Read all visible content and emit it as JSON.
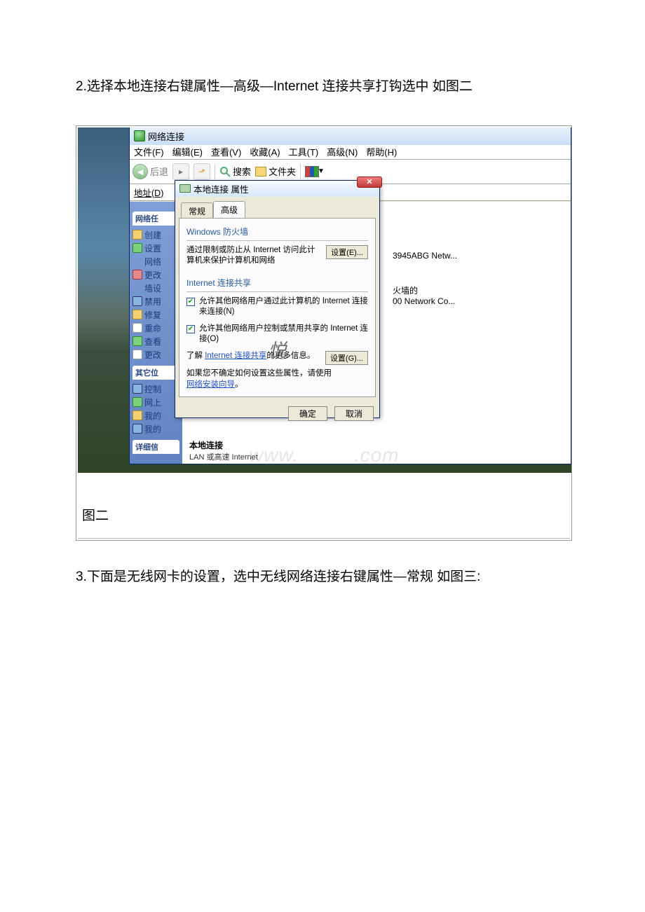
{
  "steps": {
    "s2": "2.选择本地连接右键属性—高级—Internet 连接共享打钩选中 如图二",
    "s3": "3.下面是无线网卡的设置，选中无线网络连接右键属性—常规 如图三:"
  },
  "figure_label": "图二",
  "nc_window": {
    "title": "网络连接",
    "menu": {
      "file": "文件(F)",
      "edit": "编辑(E)",
      "view": "查看(V)",
      "fav": "收藏(A)",
      "tools": "工具(T)",
      "adv": "高级(N)",
      "help": "帮助(H)"
    },
    "toolbar": {
      "back": "后退",
      "search": "搜索",
      "folders": "文件夹"
    },
    "address_label": "地址(D)",
    "left": {
      "sec_tasks": "网络任",
      "t1": "创建",
      "t2": "设置",
      "t2b": "网络",
      "t3": "更改",
      "t3b": "墙设",
      "t4": "禁用",
      "t5": "修复",
      "t6": "重命",
      "t7": "查看",
      "t8": "更改",
      "sec_other": "其它位",
      "o1": "控制",
      "o2": "网上",
      "o3": "我的",
      "o4": "我的",
      "sec_detail": "详细信"
    },
    "content": {
      "item1a": "3945ABG Netw...",
      "item2a": "火墙的",
      "item2b": "00 Network Co...",
      "sel_title": "本地连接",
      "sel_sub": "LAN 或高速 Internet"
    }
  },
  "dialog": {
    "title": "本地连接 属性",
    "tabs": {
      "general": "常规",
      "advanced": "高级"
    },
    "firewall": {
      "title": "Windows 防火墙",
      "desc": "通过限制或防止从 Internet 访问此计算机来保护计算机和网络",
      "btn": "设置(E)..."
    },
    "ics": {
      "title": "Internet 连接共享",
      "chk1": "允许其他网络用户通过此计算机的 Internet 连接来连接(N)",
      "chk2": "允许其他网络用户控制或禁用共享的 Internet 连接(O)",
      "more_pre": "了解 ",
      "more_link": "Internet 连接共享",
      "more_post": "的更多信息。",
      "btn": "设置(G)..."
    },
    "hint_pre": "如果您不确定如何设置这些属性，请使用",
    "hint_link": "网络安装向导",
    "hint_post": "。",
    "ok": "确定",
    "cancel": "取消",
    "close_tip": "关闭"
  },
  "watermark": "悦"
}
